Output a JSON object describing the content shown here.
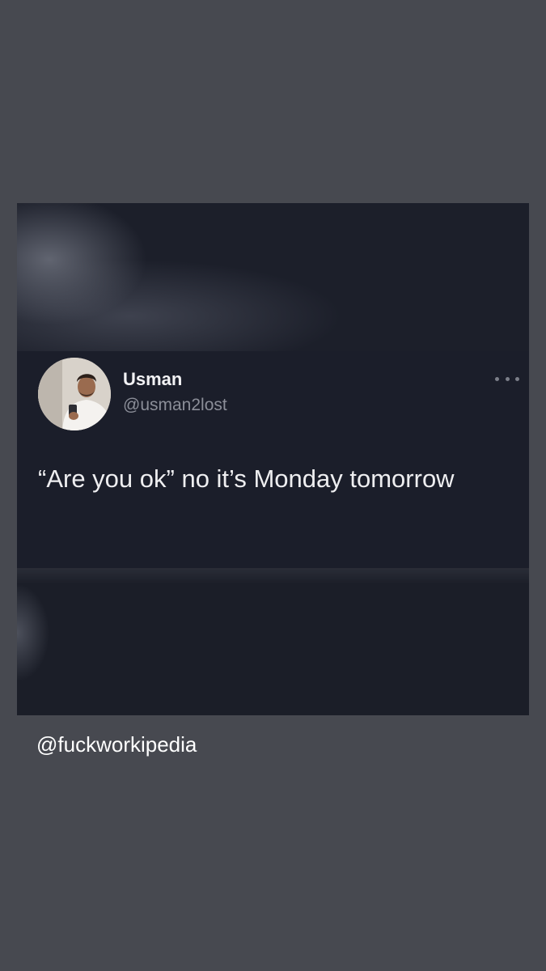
{
  "tweet": {
    "display_name": "Usman",
    "handle": "@usman2lost",
    "text": "“Are you ok” no it’s Monday tomorrow",
    "more_icon": "more-horizontal-icon",
    "avatar": "profile-photo"
  },
  "watermark": "@fuckworkipedia",
  "colors": {
    "page_background": "#474950",
    "card_background": "#1b1e2a",
    "name_text": "#f2f2f4",
    "handle_text": "#8b8e98"
  }
}
